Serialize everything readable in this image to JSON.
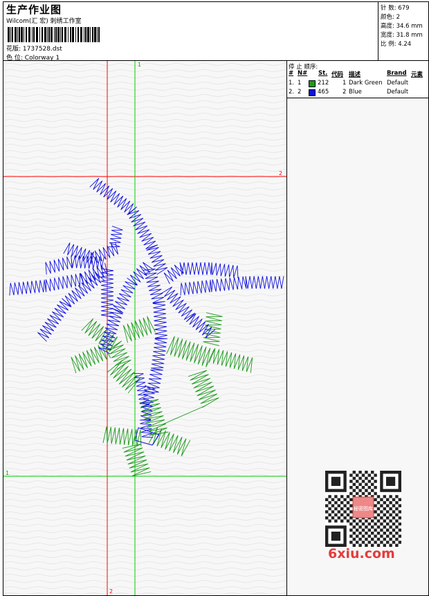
{
  "header": {
    "title": "生产作业图",
    "company": "Wilcom(汇 宏) 刺绣工作室",
    "design_label": "花版:",
    "design_file": "1737528.dst",
    "colorway_label": "色 位:",
    "colorway": "Colorway 1"
  },
  "stats": [
    {
      "label": "针 数:",
      "value": "679"
    },
    {
      "label": "颜色:",
      "value": "2"
    },
    {
      "label": "高度:",
      "value": "34.6 mm"
    },
    {
      "label": "宽度:",
      "value": "31.8 mm"
    },
    {
      "label": "比 例:",
      "value": "4.24"
    }
  ],
  "stop_sequence": {
    "title": "停 止 顺序:",
    "headers": [
      "#",
      "N#",
      "St.",
      "代码",
      "描述",
      "Brand",
      "元素"
    ],
    "rows": [
      {
        "index": "1.",
        "n": "1",
        "color": "#1a9a1a",
        "stitches": "212",
        "code": "1",
        "description": "Dark Green",
        "brand": "Default"
      },
      {
        "index": "2.",
        "n": "2",
        "color": "#1010e0",
        "stitches": "465",
        "code": "2",
        "description": "Blue",
        "brand": "Default"
      }
    ]
  },
  "guides": {
    "green_label_top": "1",
    "green_label_left": "1",
    "red_label_right": "2",
    "red_label_bottom": "2"
  },
  "colors": {
    "green_thread": "#1a9a1a",
    "blue_thread": "#1010e0",
    "red_guide": "#ff0000",
    "green_guide": "#00cc00"
  },
  "watermark": "6xiu.com",
  "qr_badge": "秘密图库"
}
